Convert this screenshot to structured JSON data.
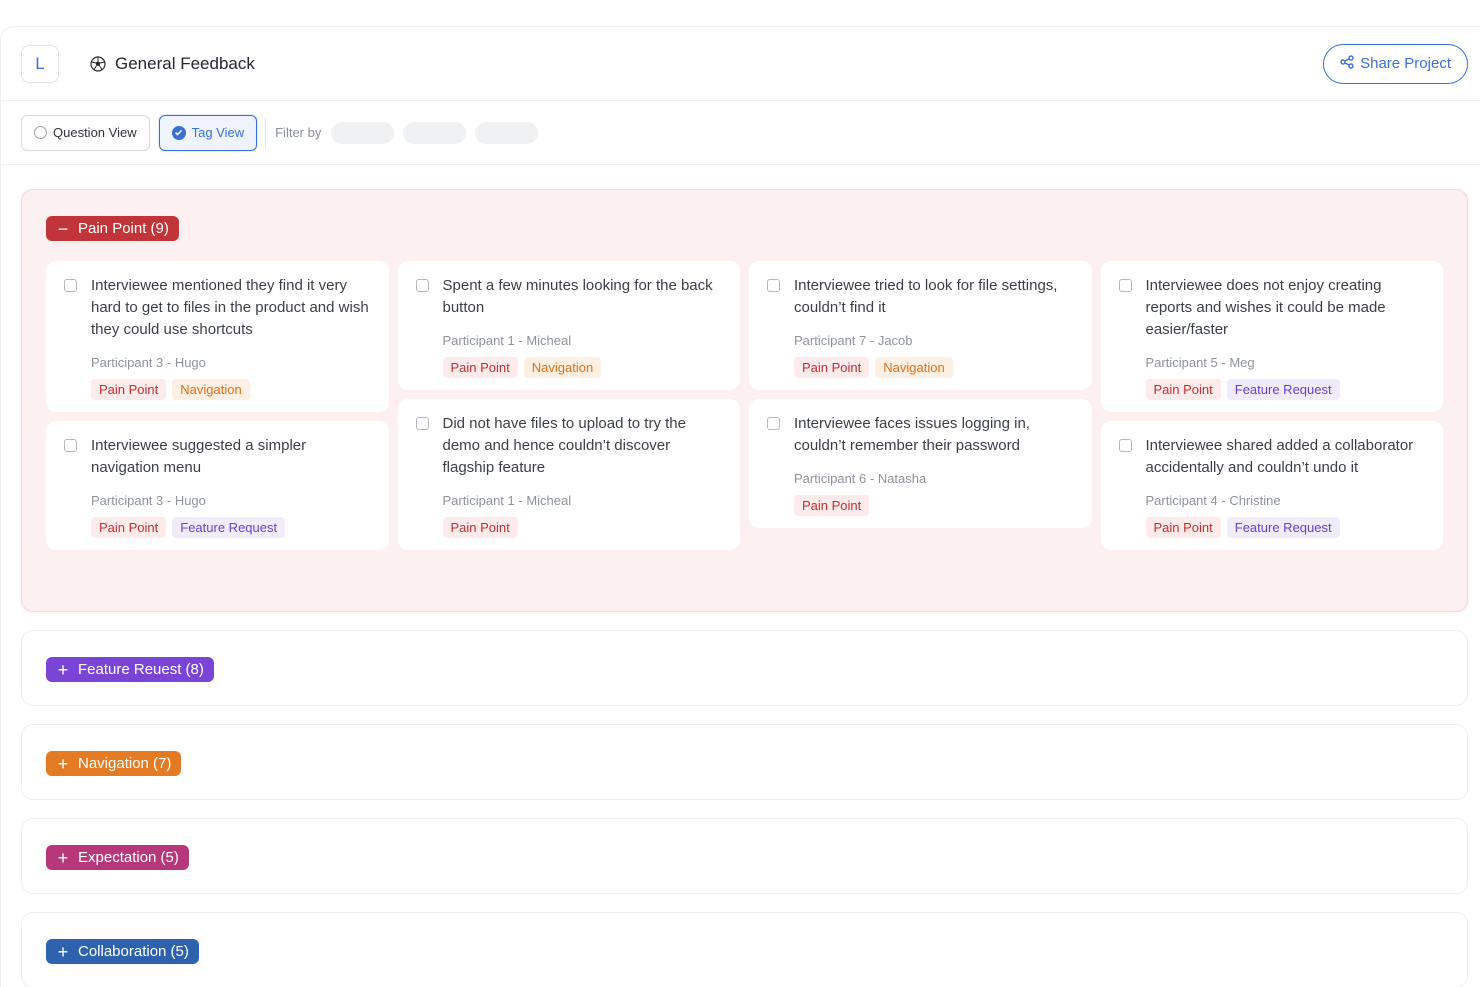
{
  "header": {
    "logo_letter": "L",
    "project_icon": "soccer-ball-icon",
    "project_title": "General Feedback",
    "share_label": "Share Project"
  },
  "toolbar": {
    "question_view": "Question View",
    "tag_view": "Tag View",
    "filter_label": "Filter by"
  },
  "colors": {
    "accent": "#3b6fd8",
    "pain": "#c0343a",
    "feature": "#7a44d6",
    "navigation": "#e57a24",
    "expectation": "#b7387a",
    "collaboration": "#2f62ad"
  },
  "groups": [
    {
      "label": "Pain Point (9)",
      "symbol": "−",
      "expanded": true
    },
    {
      "label": "Feature Reuest (8)",
      "symbol": "+"
    },
    {
      "label": "Navigation (7)",
      "symbol": "+"
    },
    {
      "label": "Expectation (5)",
      "symbol": "+"
    },
    {
      "label": "Collaboration (5)",
      "symbol": "+"
    }
  ],
  "cards": [
    {
      "quote": "Interviewee mentioned they find it very hard to get to files in the product and wish they could use shortcuts",
      "participant": "Participant 3 - Hugo",
      "tags": [
        "Pain Point",
        "Navigation"
      ]
    },
    {
      "quote": "Interviewee suggested a simpler navigation menu",
      "participant": "Participant 3 - Hugo",
      "tags": [
        "Pain Point",
        "Feature Request"
      ]
    },
    {
      "quote": "Spent a few minutes looking for the back button",
      "participant": "Participant 1 - Micheal",
      "tags": [
        "Pain Point",
        "Navigation"
      ]
    },
    {
      "quote": "Did not have files to upload to try the demo and hence couldn’t discover flagship feature",
      "participant": "Participant 1 - Micheal",
      "tags": [
        "Pain Point"
      ]
    },
    {
      "quote": "Interviewee tried to look for file settings, couldn’t find it",
      "participant": "Participant 7 - Jacob",
      "tags": [
        "Pain Point",
        "Navigation"
      ]
    },
    {
      "quote": "Interviewee faces issues logging in, couldn’t remember their password",
      "participant": "Participant 6 - Natasha",
      "tags": [
        "Pain Point"
      ]
    },
    {
      "quote": "Interviewee does not enjoy creating reports and wishes it could be made easier/faster",
      "participant": "Participant 5 - Meg",
      "tags": [
        "Pain Point",
        "Feature Request"
      ]
    },
    {
      "quote": "Interviewee shared added a collaborator accidentally and couldn’t undo it",
      "participant": "Participant 4 - Christine",
      "tags": [
        "Pain Point",
        "Feature Request"
      ]
    }
  ]
}
